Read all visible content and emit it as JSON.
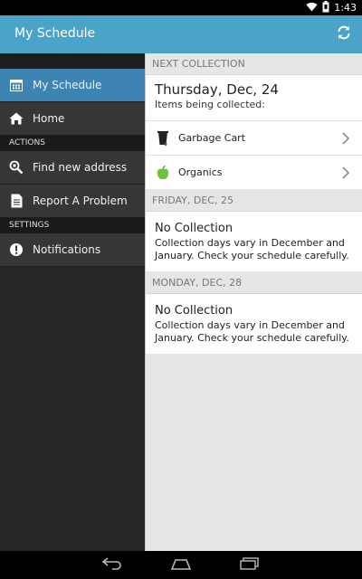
{
  "status_bar": {
    "time": "1:43"
  },
  "app": {
    "title": "My Schedule"
  },
  "drawer": {
    "items_top": [
      {
        "label": "My Schedule",
        "icon": "calendar-icon",
        "active": true
      },
      {
        "label": "Home",
        "icon": "home-icon",
        "active": false
      }
    ],
    "actions_header": "ACTIONS",
    "actions": [
      {
        "label": "Find new address",
        "icon": "search-address-icon"
      },
      {
        "label": "Report A Problem",
        "icon": "report-icon"
      }
    ],
    "settings_header": "SETTINGS",
    "settings": [
      {
        "label": "Notifications",
        "icon": "alert-icon"
      }
    ]
  },
  "next_collection": {
    "header": "NEXT COLLECTION",
    "date": "Thursday, Dec, 24",
    "subtitle": "Items being collected:",
    "items": [
      {
        "label": "Garbage Cart",
        "icon": "garbage-cart-icon"
      },
      {
        "label": "Organics",
        "icon": "apple-icon"
      }
    ]
  },
  "upcoming": [
    {
      "header": "FRIDAY, DEC, 25",
      "title": "No Collection",
      "text": "Collection days vary in December and January. Check your schedule carefully."
    },
    {
      "header": "MONDAY, DEC, 28",
      "title": "No Collection",
      "text": "Collection days vary in December and January. Check your schedule carefully."
    }
  ],
  "colors": {
    "action_bar": "#4aa3c8",
    "drawer_active": "#3e84b3",
    "drawer_bg": "#363636",
    "organics_green": "#6cc33c"
  }
}
